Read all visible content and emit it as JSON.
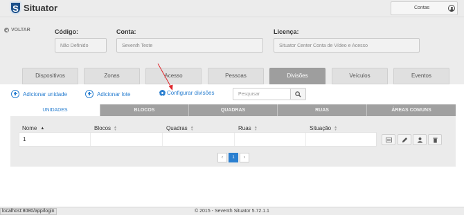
{
  "app": {
    "name": "Situator",
    "logo_letter": "S"
  },
  "header": {
    "account_label": "Contas",
    "account_icon": "user-circle-icon"
  },
  "back": {
    "label": "VOLTAR",
    "icon": "back-circle-icon"
  },
  "fields": {
    "codigo": {
      "label": "Código:",
      "value": "Não Definido"
    },
    "conta": {
      "label": "Conta:",
      "value": "Seventh Teste"
    },
    "licenca": {
      "label": "Licença:",
      "value": "Situator Center Conta de Vídeo e Acesso"
    }
  },
  "tabs": [
    {
      "label": "Dispositivos",
      "active": false
    },
    {
      "label": "Zonas",
      "active": false
    },
    {
      "label": "Acesso",
      "active": false
    },
    {
      "label": "Pessoas",
      "active": false
    },
    {
      "label": "Divisões",
      "active": true
    },
    {
      "label": "Veículos",
      "active": false
    },
    {
      "label": "Eventos",
      "active": false
    }
  ],
  "actions": {
    "add_unit": "Adicionar unidade",
    "add_batch": "Adicionar lote",
    "configure": "Configurar divisões"
  },
  "search": {
    "placeholder": "Pesquisar",
    "icon": "search-icon"
  },
  "subtabs": [
    {
      "label": "UNIDADES",
      "active": true
    },
    {
      "label": "BLOCOS",
      "active": false
    },
    {
      "label": "QUADRAS",
      "active": false
    },
    {
      "label": "RUAS",
      "active": false
    },
    {
      "label": "ÁREAS COMUNS",
      "active": false
    }
  ],
  "table": {
    "columns": [
      "Nome",
      "Blocos",
      "Quadras",
      "Ruas",
      "Situação"
    ],
    "rows": [
      {
        "cells": [
          "1",
          "",
          "",
          "",
          ""
        ]
      }
    ],
    "row_actions": [
      "list-icon",
      "edit-pencil-icon",
      "person-icon",
      "trash-icon"
    ]
  },
  "pagination": {
    "prev": "‹",
    "current": "1",
    "next": "›"
  },
  "footer": {
    "text": "© 2015 - Seventh Situator 5.72.1.1"
  },
  "status_url": "localhost:8080/app/login",
  "colors": {
    "accent": "#2a7fd0",
    "active_tab": "#9e9e9e",
    "brand": "#1a4f8a",
    "annotation_arrow": "#e0262b"
  }
}
